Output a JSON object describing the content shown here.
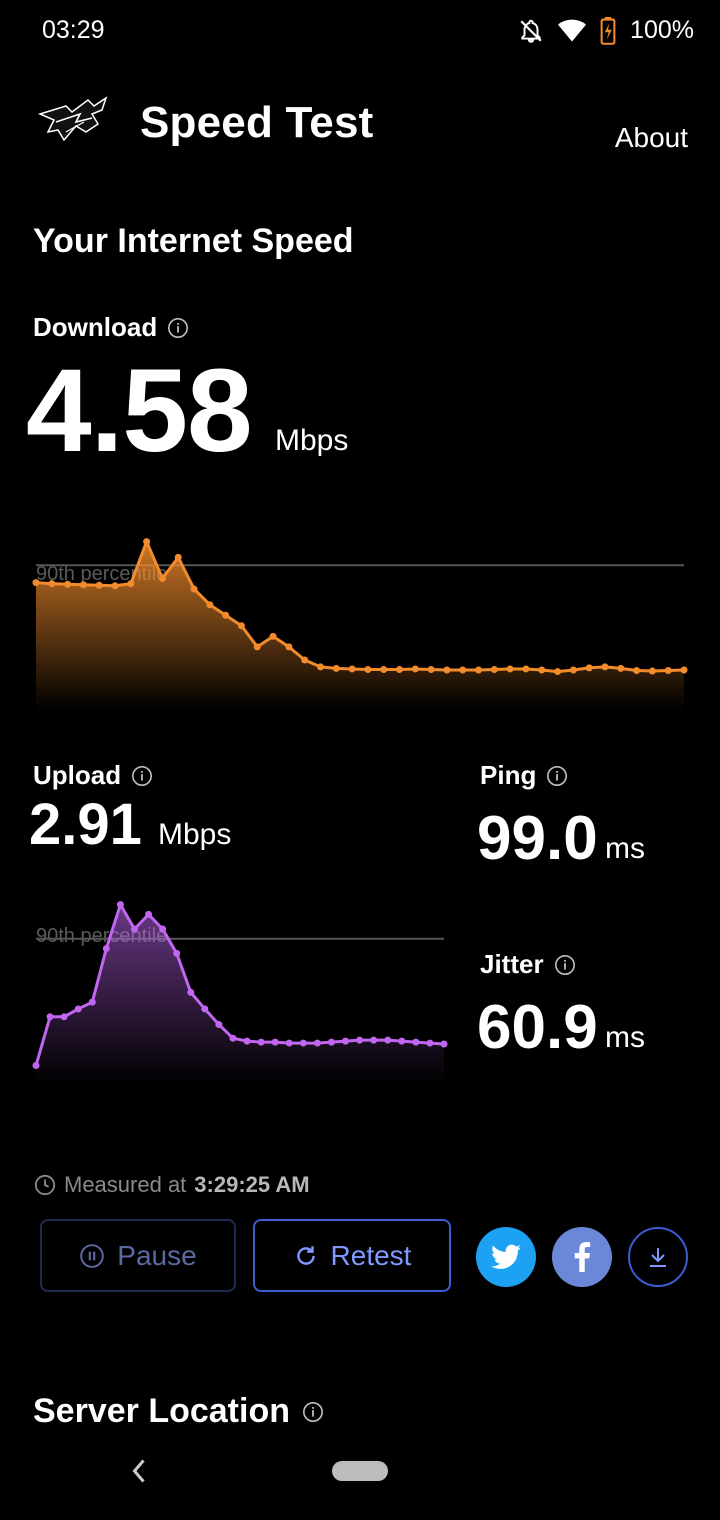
{
  "status_bar": {
    "time": "03:29",
    "battery": "100%"
  },
  "header": {
    "title": "Speed Test",
    "about_label": "About"
  },
  "main": {
    "section_title": "Your Internet Speed",
    "download": {
      "label": "Download",
      "value": "4.58",
      "unit": "Mbps",
      "percentile_label": "90th percentile"
    },
    "upload": {
      "label": "Upload",
      "value": "2.91",
      "unit": "Mbps",
      "percentile_label": "90th percentile"
    },
    "ping": {
      "label": "Ping",
      "value": "99.0",
      "unit": "ms"
    },
    "jitter": {
      "label": "Jitter",
      "value": "60.9",
      "unit": "ms"
    },
    "measured": {
      "prefix": "Measured at",
      "time": "3:29:25 AM"
    },
    "buttons": {
      "pause": "Pause",
      "retest": "Retest"
    },
    "server_title": "Server Location"
  },
  "colors": {
    "download": "#f28b2c",
    "upload": "#c066f0",
    "accent": "#3d5bd0",
    "twitter": "#1da1f2",
    "facebook": "#6b88d8"
  },
  "chart_data": [
    {
      "type": "area",
      "series": [
        {
          "values": [
            24.2,
            24.0,
            23.9,
            23.8,
            23.7,
            23.6,
            24.0,
            32.0,
            25.0,
            29.0,
            23.0,
            20.0,
            18.0,
            16.0,
            12.0,
            14.0,
            12.0,
            9.5,
            8.2,
            7.9,
            7.8,
            7.7,
            7.7,
            7.7,
            7.8,
            7.7,
            7.6,
            7.6,
            7.6,
            7.7,
            7.8,
            7.8,
            7.6,
            7.3,
            7.6,
            8.0,
            8.2,
            7.9,
            7.5,
            7.4,
            7.5,
            7.6
          ]
        }
      ],
      "ylim": [
        0,
        38
      ],
      "reference_line": 27.5
    },
    {
      "type": "area",
      "series": [
        {
          "values": [
            2.0,
            7.0,
            7.0,
            7.8,
            8.5,
            14.0,
            18.5,
            16.0,
            17.5,
            16.0,
            13.5,
            9.5,
            7.8,
            6.2,
            4.8,
            4.5,
            4.4,
            4.4,
            4.3,
            4.3,
            4.3,
            4.4,
            4.5,
            4.6,
            4.6,
            4.6,
            4.5,
            4.4,
            4.3,
            4.2
          ]
        }
      ],
      "ylim": [
        0,
        20
      ],
      "reference_line": 15.0
    }
  ]
}
